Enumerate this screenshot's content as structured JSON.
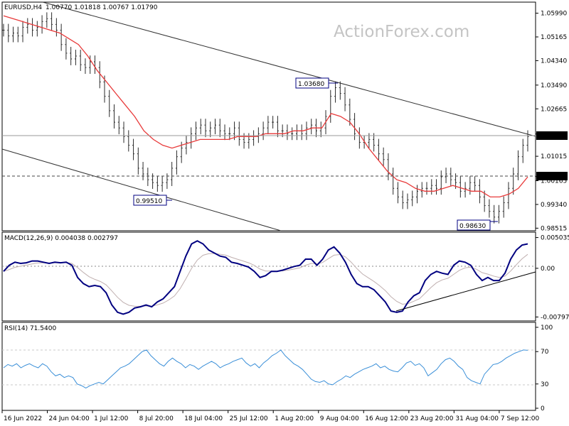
{
  "header": {
    "symbol": "EURUSD,H4",
    "ohlc": "1.00770 1.01818 1.00767 1.01790",
    "watermark": "ActionForex.com"
  },
  "chart_data": [
    {
      "type": "bar",
      "name": "price",
      "title": "EURUSD,H4 1.00770 1.01818 1.00767 1.01790",
      "ylim": [
        0.9845,
        1.0635
      ],
      "yticks": [
        "1.05990",
        "1.05165",
        "1.04340",
        "1.03490",
        "1.02665",
        "1.01790",
        "1.01015",
        "1.00310",
        "1.00165",
        "0.99340",
        "0.98515"
      ],
      "xticks": [
        "16 Jun 2022",
        "24 Jun 04:00",
        "1 Jul 12:00",
        "8 Jul 20:00",
        "18 Jul 04:00",
        "25 Jul 12:00",
        "1 Aug 20:00",
        "9 Aug 04:00",
        "16 Aug 12:00",
        "23 Aug 20:00",
        "31 Aug 04:00",
        "7 Sep 12:00"
      ],
      "close_series": [
        1.054,
        1.052,
        1.053,
        1.052,
        1.055,
        1.056,
        1.054,
        1.055,
        1.057,
        1.058,
        1.056,
        1.054,
        1.049,
        1.046,
        1.044,
        1.045,
        1.042,
        1.041,
        1.043,
        1.041,
        1.036,
        1.031,
        1.026,
        1.022,
        1.02,
        1.017,
        1.014,
        1.011,
        1.006,
        1.004,
        1.002,
        1.001,
        1.0,
        1.001,
        1.002,
        1.006,
        1.01,
        1.013,
        1.015,
        1.018,
        1.02,
        1.021,
        1.019,
        1.02,
        1.021,
        1.019,
        1.018,
        1.018,
        1.02,
        1.016,
        1.015,
        1.016,
        1.017,
        1.018,
        1.02,
        1.022,
        1.022,
        1.019,
        1.019,
        1.018,
        1.018,
        1.019,
        1.018,
        1.02,
        1.021,
        1.019,
        1.02,
        1.024,
        1.031,
        1.034,
        1.032,
        1.028,
        1.023,
        1.018,
        1.015,
        1.015,
        1.016,
        1.014,
        1.011,
        1.009,
        1.004,
        0.999,
        0.996,
        0.994,
        0.995,
        0.996,
        0.998,
        0.999,
        0.999,
        1.0,
        0.999,
        1.003,
        1.004,
        1.002,
        1.001,
        0.998,
        0.999,
        1.001,
        1.0,
        0.996,
        0.993,
        0.991,
        0.989,
        0.991,
        0.994,
        0.999,
        1.004,
        1.01,
        1.014,
        1.017
      ],
      "ma_series": [
        1.059,
        1.058,
        1.057,
        1.056,
        1.055,
        1.054,
        1.053,
        1.051,
        1.049,
        1.045,
        1.04,
        1.036,
        1.032,
        1.028,
        1.024,
        1.019,
        1.016,
        1.014,
        1.013,
        1.014,
        1.015,
        1.016,
        1.016,
        1.016,
        1.016,
        1.017,
        1.017,
        1.017,
        1.018,
        1.018,
        1.018,
        1.019,
        1.019,
        1.02,
        1.02,
        1.025,
        1.024,
        1.022,
        1.018,
        1.013,
        1.009,
        1.005,
        1.002,
        1.001,
        0.999,
        0.998,
        0.998,
        0.999,
        1.0,
        0.999,
        0.998,
        0.998,
        0.996,
        0.996,
        0.997,
        0.999,
        1.003
      ],
      "horizontal_lines": [
        {
          "label": "1.01790",
          "value": 1.0179,
          "style": "solid"
        },
        {
          "label": "1.00310",
          "value": 1.0031,
          "style": "dashed"
        }
      ],
      "annotations": [
        {
          "label": "1.03680",
          "value": 1.0368
        },
        {
          "label": "0.99510",
          "value": 0.9951
        },
        {
          "label": "0.98630",
          "value": 0.9863
        }
      ],
      "colors": {
        "bars": "#2b2b2b",
        "ma": "#e83a3a",
        "trend": "#000000"
      }
    },
    {
      "type": "line",
      "name": "macd",
      "title": "MACD(12,26,9) 0.004038 0.002797",
      "ylim": [
        -0.0085,
        0.0058
      ],
      "yticks": [
        "0.005035",
        "0.00",
        "-0.007973"
      ],
      "macd_series": [
        -0.0005,
        0.0005,
        0.001,
        0.0008,
        0.0009,
        0.0012,
        0.0012,
        0.001,
        0.0008,
        0.001,
        0.0009,
        0.001,
        0.0005,
        -0.0015,
        -0.0025,
        -0.003,
        -0.0028,
        -0.003,
        -0.004,
        -0.006,
        -0.0072,
        -0.0075,
        -0.0072,
        -0.0065,
        -0.0063,
        -0.006,
        -0.0063,
        -0.0055,
        -0.005,
        -0.004,
        -0.003,
        -0.0005,
        0.002,
        0.004,
        0.0045,
        0.004,
        0.003,
        0.0025,
        0.002,
        0.0018,
        0.001,
        0.0008,
        0.0005,
        0.0002,
        -0.0005,
        -0.0015,
        -0.0012,
        -0.0005,
        -0.0005,
        -0.0003,
        0.0,
        0.0003,
        0.0005,
        0.0015,
        0.0015,
        0.0005,
        0.0015,
        0.003,
        0.0035,
        0.0025,
        0.001,
        -0.001,
        -0.0025,
        -0.003,
        -0.003,
        -0.0035,
        -0.0045,
        -0.0055,
        -0.007,
        -0.0072,
        -0.007,
        -0.0055,
        -0.0045,
        -0.004,
        -0.002,
        -0.001,
        -0.0005,
        -0.0008,
        -0.001,
        0.0005,
        0.0012,
        0.001,
        0.0005,
        -0.001,
        -0.002,
        -0.0015,
        -0.002,
        -0.002,
        -0.0008,
        0.0015,
        0.003,
        0.0038,
        0.004
      ],
      "colors": {
        "macd": "#000080",
        "signal": "#c0b0b0"
      }
    },
    {
      "type": "line",
      "name": "rsi",
      "title": "RSI(14) 71.5400",
      "ylim": [
        0,
        100
      ],
      "yticks": [
        "100",
        "70",
        "30",
        "0"
      ],
      "levels": [
        70,
        30
      ],
      "series_values": [
        50,
        54,
        52,
        55,
        50,
        53,
        55,
        52,
        50,
        55,
        52,
        45,
        40,
        42,
        38,
        40,
        38,
        30,
        28,
        25,
        28,
        30,
        32,
        30,
        35,
        40,
        45,
        50,
        52,
        55,
        60,
        65,
        70,
        72,
        65,
        60,
        55,
        52,
        58,
        62,
        58,
        55,
        50,
        54,
        52,
        48,
        52,
        55,
        58,
        55,
        50,
        53,
        55,
        58,
        60,
        62,
        56,
        52,
        55,
        50,
        56,
        60,
        65,
        68,
        72,
        65,
        60,
        55,
        52,
        48,
        42,
        36,
        33,
        32,
        34,
        30,
        29,
        33,
        36,
        40,
        38,
        42,
        45,
        48,
        50,
        52,
        55,
        50,
        52,
        48,
        46,
        45,
        50,
        56,
        58,
        53,
        55,
        50,
        40,
        44,
        48,
        55,
        60,
        62,
        58,
        52,
        48,
        38,
        34,
        32,
        30,
        42,
        48,
        54,
        55,
        58,
        62,
        65,
        68,
        70,
        72,
        71.54
      ],
      "colors": {
        "line": "#3a8fd8",
        "levels": "#c9c9c9"
      }
    }
  ]
}
